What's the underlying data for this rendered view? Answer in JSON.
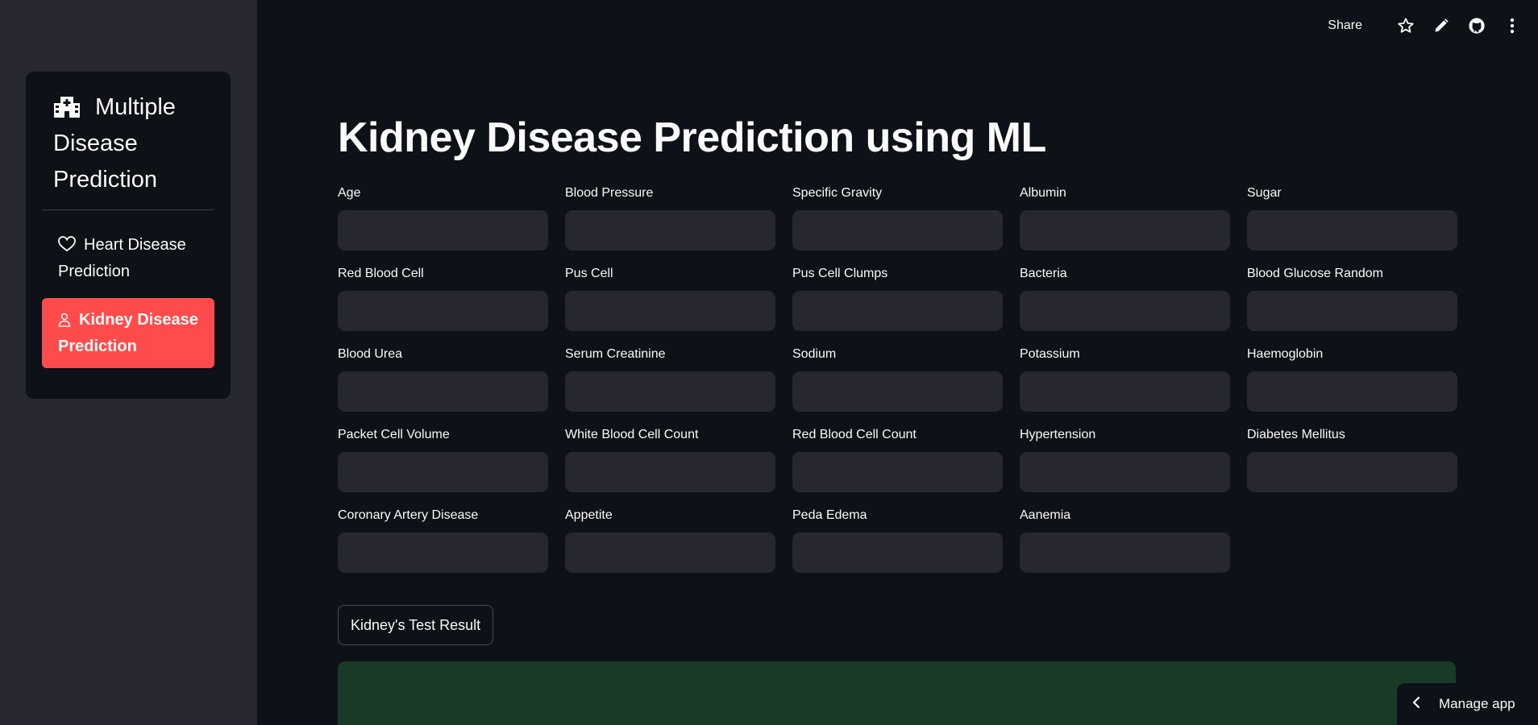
{
  "sidebar": {
    "title": "Multiple Disease Prediction",
    "title_icon": "hospital-icon",
    "items": [
      {
        "label": "Heart Disease Prediction",
        "icon": "heart-icon",
        "active": false
      },
      {
        "label": "Kidney Disease Prediction",
        "icon": "person-icon",
        "active": true
      }
    ]
  },
  "toolbar": {
    "share_label": "Share",
    "icons": [
      "star-icon",
      "pencil-icon",
      "github-icon",
      "kebab-menu-icon"
    ]
  },
  "main": {
    "title": "Kidney Disease Prediction using ML",
    "fields": [
      {
        "label": "Age",
        "value": ""
      },
      {
        "label": "Blood Pressure",
        "value": ""
      },
      {
        "label": "Specific Gravity",
        "value": ""
      },
      {
        "label": "Albumin",
        "value": ""
      },
      {
        "label": "Sugar",
        "value": ""
      },
      {
        "label": "Red Blood Cell",
        "value": ""
      },
      {
        "label": "Pus Cell",
        "value": ""
      },
      {
        "label": "Pus Cell Clumps",
        "value": ""
      },
      {
        "label": "Bacteria",
        "value": ""
      },
      {
        "label": "Blood Glucose Random",
        "value": ""
      },
      {
        "label": "Blood Urea",
        "value": ""
      },
      {
        "label": "Serum Creatinine",
        "value": ""
      },
      {
        "label": "Sodium",
        "value": ""
      },
      {
        "label": "Potassium",
        "value": ""
      },
      {
        "label": "Haemoglobin",
        "value": ""
      },
      {
        "label": "Packet Cell Volume",
        "value": ""
      },
      {
        "label": "White Blood Cell Count",
        "value": ""
      },
      {
        "label": "Red Blood Cell Count",
        "value": ""
      },
      {
        "label": "Hypertension",
        "value": ""
      },
      {
        "label": "Diabetes Mellitus",
        "value": ""
      },
      {
        "label": "Coronary Artery Disease",
        "value": ""
      },
      {
        "label": "Appetite",
        "value": ""
      },
      {
        "label": "Peda Edema",
        "value": ""
      },
      {
        "label": "Aanemia",
        "value": ""
      }
    ],
    "result_button": "Kidney's Test Result"
  },
  "manage_app": {
    "label": "Manage app",
    "icon": "chevron-left-icon"
  },
  "colors": {
    "background": "#0e1117",
    "sidebar": "#262730",
    "accent": "#ff4b4b",
    "input": "#262730",
    "success": "#1a3a28"
  }
}
